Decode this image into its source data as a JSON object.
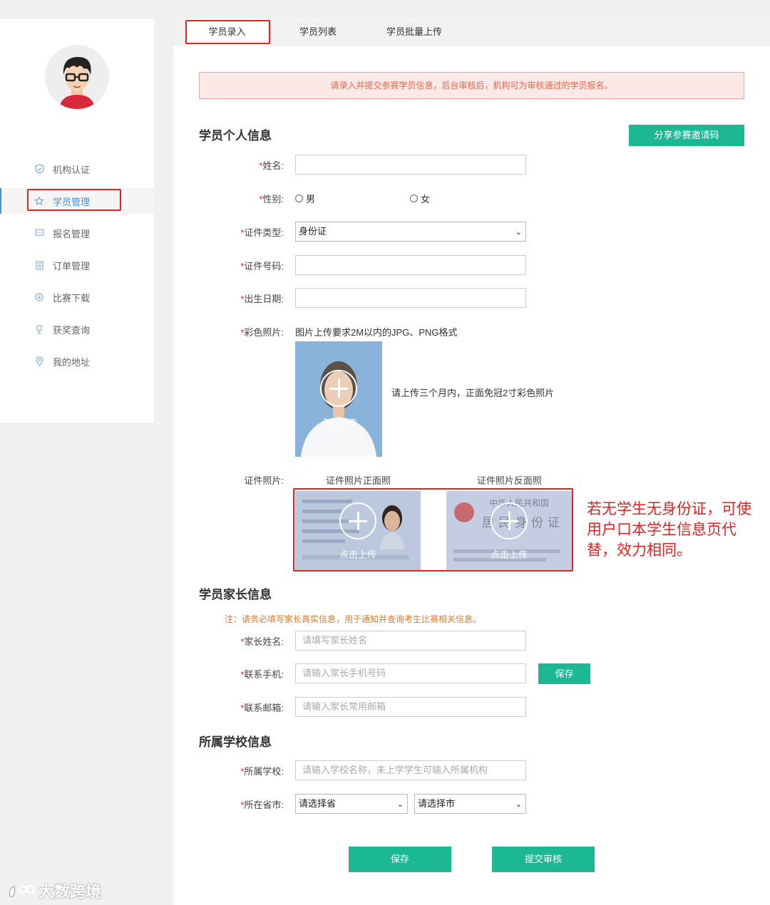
{
  "sidebar": {
    "items": [
      {
        "label": "机构认证",
        "icon": "shield-check-icon"
      },
      {
        "label": "学员管理",
        "icon": "star-icon"
      },
      {
        "label": "报名管理",
        "icon": "chat-icon"
      },
      {
        "label": "订单管理",
        "icon": "document-icon"
      },
      {
        "label": "比赛下载",
        "icon": "download-icon"
      },
      {
        "label": "获奖查询",
        "icon": "trophy-icon"
      },
      {
        "label": "我的地址",
        "icon": "location-pin-icon"
      }
    ],
    "active_index": 1
  },
  "tabs": [
    "学员录入",
    "学员列表",
    "学员批量上传"
  ],
  "notice": "请录入并提交参赛学员信息，后台审核后，机构可为审核通过的学员报名。",
  "personal": {
    "title": "学员个人信息",
    "share_button": "分享参赛邀请码",
    "name_label": "姓名:",
    "gender_label": "性别:",
    "gender_male": "男",
    "gender_female": "女",
    "id_type_label": "证件类型:",
    "id_type_value": "身份证",
    "id_number_label": "证件号码:",
    "birth_label": "出生日期:",
    "photo_label": "彩色照片:",
    "photo_requirement": "图片上传要求2M以内的JPG、PNG格式",
    "photo_hint": "请上传三个月内，正面免冠2寸彩色照片",
    "upload_text": "点击上传",
    "id_photo_label": "证件照片:",
    "id_front_caption": "证件照片正面照",
    "id_back_caption": "证件照片反面照",
    "id_back_text_1": "中华人民共和国",
    "id_back_text_2": "居民身份证"
  },
  "annotation": "若无学生无身份证，可使用户口本学生信息页代替，效力相同。",
  "parent": {
    "title": "学员家长信息",
    "note": "注：请务必填写家长真实信息，用于通知并查询考生比赛相关信息。",
    "name_label": "家长姓名:",
    "name_placeholder": "请填写家长姓名",
    "phone_label": "联系手机:",
    "phone_placeholder": "请输入家长手机号码",
    "save_button": "保存",
    "email_label": "联系邮箱:",
    "email_placeholder": "请输入家长常用邮箱"
  },
  "school": {
    "title": "所属学校信息",
    "school_label": "所属学校:",
    "school_placeholder": "请输入学校名称，未上学学生可输入所属机构",
    "city_label": "所在省市:",
    "province_value": "请选择省",
    "city_value": "请选择市"
  },
  "footer": {
    "save_button": "保存",
    "submit_button": "提交审核"
  },
  "watermark": "大数跨境",
  "colors": {
    "accent_green": "#1cb894",
    "highlight_red": "#e02424",
    "notice_bg": "#fde8e8",
    "active_nav": "#4a90d9"
  }
}
